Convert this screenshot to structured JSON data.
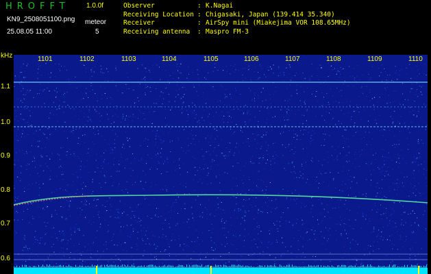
{
  "header": {
    "app_title": "HROFFT",
    "version": "1.0.0f",
    "filename": "KN9_2508051100.png",
    "mode": "meteor",
    "datetime": "25.08.05 11:00",
    "count": "5"
  },
  "station_info": [
    {
      "key": "Observer",
      "value": "K.Nagai"
    },
    {
      "key": "Receiving Location",
      "value": "Chigasaki, Japan (139.414 35.340)"
    },
    {
      "key": "Receiver",
      "value": "AirSpy mini (Miakejima VOR 108.65MHz)"
    },
    {
      "key": "Receiving antenna",
      "value": "Maspro FM-3"
    }
  ],
  "axes": {
    "y_unit": "kHz",
    "y_ticks": [
      "1.1",
      "1.0",
      "0.9",
      "0.8",
      "0.7",
      "0.6"
    ],
    "x_ticks": [
      "1101",
      "1102",
      "1103",
      "1104",
      "1105",
      "1106",
      "1107",
      "1108",
      "1109",
      "1110"
    ]
  },
  "colors": {
    "background": "#000000",
    "plot_background": "#0a1a8c",
    "title_green": "#1fbf2b",
    "label_yellow": "#ffff00"
  }
}
